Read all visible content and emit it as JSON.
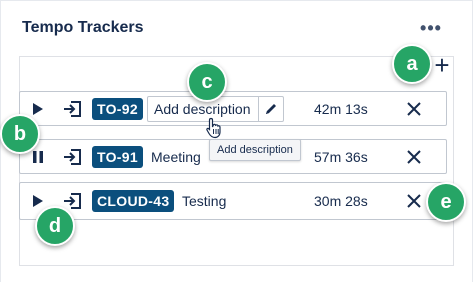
{
  "header": {
    "title": "Tempo Trackers",
    "more_label": "•••"
  },
  "toolbar": {
    "add_label": "+"
  },
  "trackers": [
    {
      "state": "stopped",
      "issue_key": "TO-92",
      "description": "Add description",
      "description_placeholder": "Add description",
      "time": "42m 13s"
    },
    {
      "state": "running",
      "issue_key": "TO-91",
      "description": "Meeting",
      "time": "57m 36s"
    },
    {
      "state": "stopped",
      "issue_key": "CLOUD-43",
      "description": "Testing",
      "time": "30m 28s"
    }
  ],
  "tooltip": {
    "text": "Add description"
  },
  "callouts": {
    "a": "a",
    "b": "b",
    "c": "c",
    "d": "d",
    "e": "e"
  },
  "colors": {
    "issue_key_bg": "#0b4f7d",
    "callout_bg": "#26a566",
    "text": "#172b4d",
    "border": "#c1c7d0"
  },
  "icons": {
    "more": "more-icon",
    "add": "plus-icon",
    "play": "play-icon",
    "pause": "pause-icon",
    "log": "log-time-icon",
    "edit": "pencil-icon",
    "close": "close-icon"
  }
}
